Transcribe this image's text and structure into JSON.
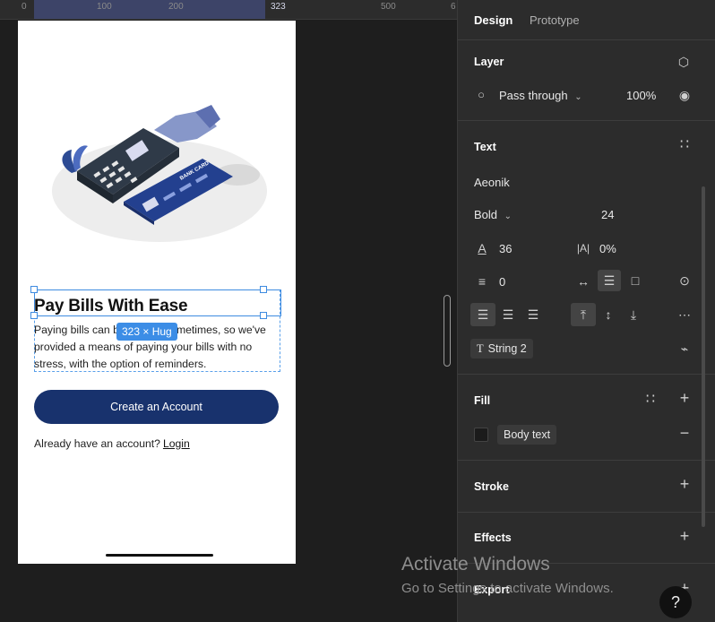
{
  "ruler": {
    "ticks": [
      "0",
      "100",
      "200",
      "323",
      "500",
      "6"
    ]
  },
  "phone": {
    "title": "Pay Bills With Ease",
    "body": "Paying bills can be difficult sometimes, so we've provided a means of paying your bills with no stress, with the option of reminders.",
    "selection_badge": "323 × Hug",
    "cta_label": "Create an Account",
    "already_text": "Already have an account?",
    "login_label": "Login",
    "card_label": "BANK CARD"
  },
  "panel": {
    "tabs": {
      "design": "Design",
      "prototype": "Prototype"
    },
    "layer": {
      "title": "Layer",
      "blend_mode": "Pass through",
      "opacity": "100%"
    },
    "text": {
      "title": "Text",
      "font_family": "Aeonik",
      "font_weight": "Bold",
      "font_size": "24",
      "line_height": "36",
      "letter_spacing": "0%",
      "paragraph_spacing": "0",
      "style_variable": "String 2"
    },
    "fill": {
      "title": "Fill",
      "style_name": "Body text"
    },
    "stroke": {
      "title": "Stroke"
    },
    "effects": {
      "title": "Effects"
    },
    "export": {
      "title": "Export"
    }
  },
  "overlay": {
    "activate_title": "Activate Windows",
    "activate_sub": "Go to Settings to activate Windows.",
    "help": "?"
  },
  "colors": {
    "cta_background": "#18326d",
    "selection": "#3e8be0",
    "panel_background": "#2c2c2c",
    "canvas_background": "#1e1e1e"
  }
}
